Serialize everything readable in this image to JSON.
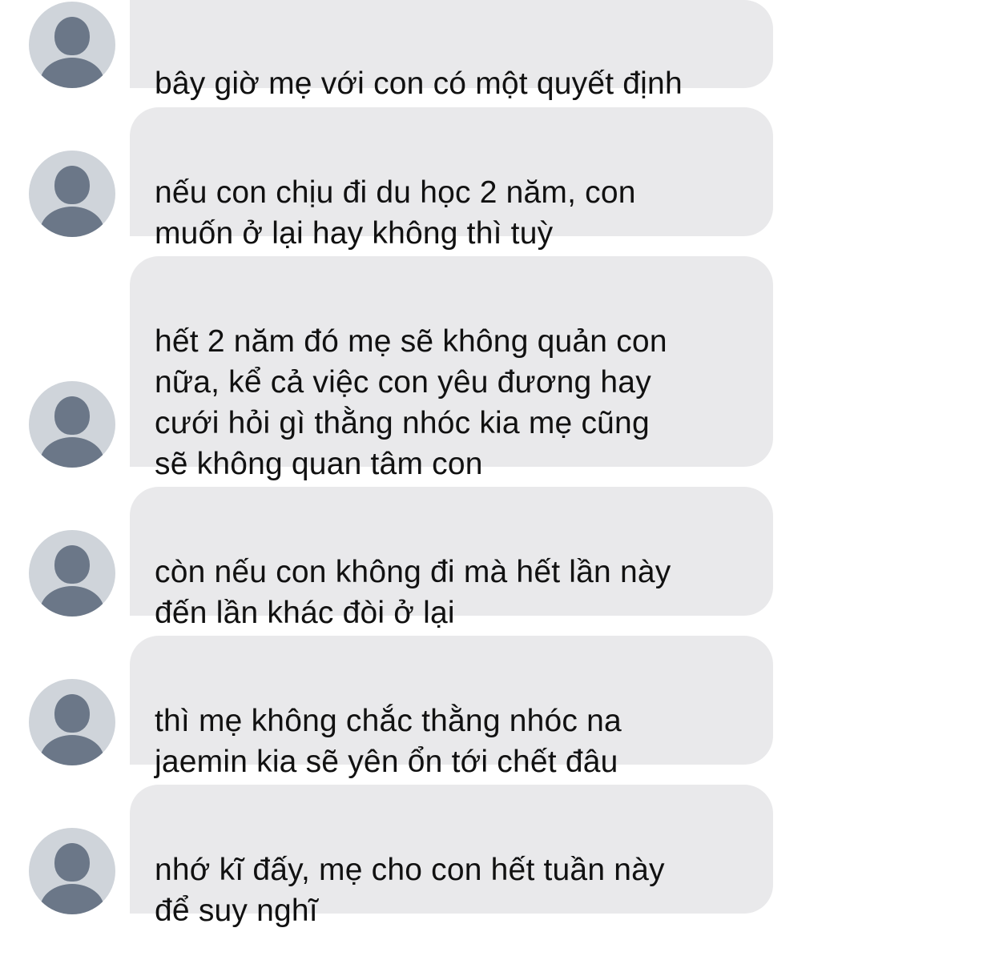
{
  "conversation": {
    "messages": [
      {
        "text": "bây giờ mẹ với con có một quyết định"
      },
      {
        "text": "nếu con chịu đi du học 2 năm, con\nmuốn ở lại hay không thì tuỳ"
      },
      {
        "text": "hết 2 năm đó mẹ sẽ không quản con\nnữa, kể cả việc con yêu đương hay\ncưới hỏi gì thằng nhóc kia mẹ cũng\nsẽ không quan tâm con"
      },
      {
        "text": "còn nếu con không đi mà hết lần này\nđến lần khác đòi ở lại"
      },
      {
        "text": "thì mẹ không chắc thằng nhóc na\njaemin kia sẽ yên ổn tới chết đâu"
      },
      {
        "text": "nhớ kĩ đấy, mẹ cho con hết tuần này\nđể suy nghĩ"
      }
    ],
    "avatar_icon": "default-user-avatar-icon",
    "colors": {
      "bubble": "#e9e9eb",
      "avatar_bg": "#cfd4da",
      "avatar_fg": "#6b7788",
      "text": "#111111"
    }
  }
}
